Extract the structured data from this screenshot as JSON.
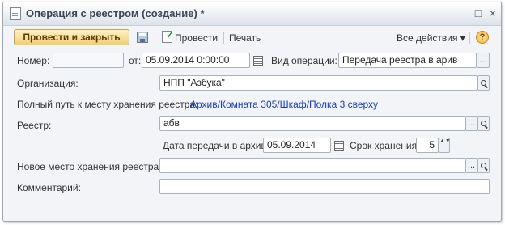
{
  "window": {
    "title": "Операция с реестром (создание) *",
    "controls": [
      "_",
      "□",
      "×"
    ]
  },
  "toolbar": {
    "post_close_label": "Провести и закрыть",
    "post_label": "Провести",
    "print_label": "Печать",
    "all_actions_label": "Все действия ▾",
    "help_label": "?"
  },
  "form": {
    "number_label": "Номер:",
    "number_value": "",
    "from_label": "от:",
    "date_value": "05.09.2014  0:00:00",
    "operation_type_label": "Вид операции:",
    "operation_type_value": "Передача реестра в арив",
    "organization_label": "Организация:",
    "organization_value": "НПП \"Азбука\"",
    "storage_path_label": "Полный путь к месту хранения реестра:",
    "storage_path_value": "Архив/Комната 305/Шкаф/Полка 3 сверху",
    "registry_label": "Реестр:",
    "registry_value": "абв",
    "archive_date_label": "Дата передачи в архив:",
    "archive_date_value": "05.09.2014",
    "retention_label": "Срок хранения:",
    "retention_value": "5",
    "new_location_label": "Новое место хранения реестра:",
    "new_location_value": "",
    "comment_label": "Комментарий:",
    "comment_value": ""
  },
  "icons": {
    "select_button": "...",
    "stepper": "▲▼"
  }
}
